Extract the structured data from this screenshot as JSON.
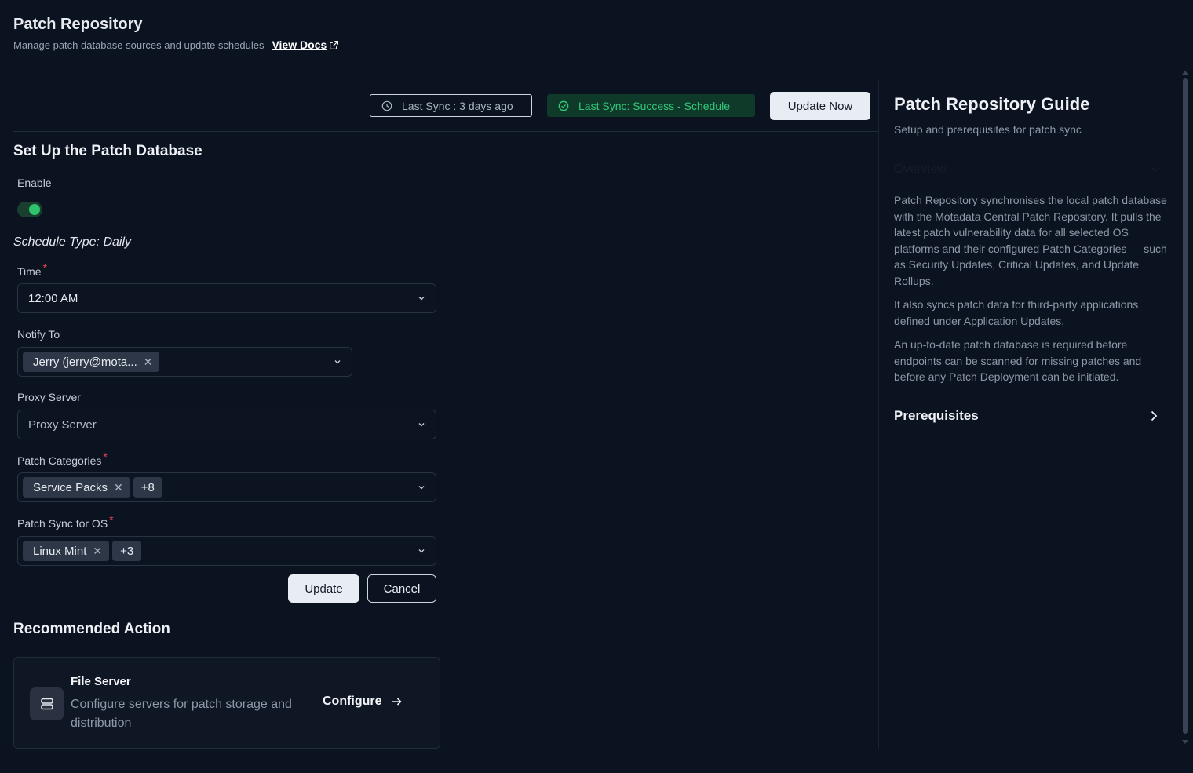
{
  "header": {
    "title": "Patch Repository",
    "subtitle": "Manage patch database sources and update schedules",
    "docs_link": "View Docs"
  },
  "toolbar": {
    "last_sync": "Last Sync : 3 days ago",
    "sync_status": "Last Sync: Success - Schedule",
    "update_now": "Update Now"
  },
  "form": {
    "section_title": "Set Up the Patch Database",
    "enable_label": "Enable",
    "enabled": true,
    "schedule_type": "Schedule Type: Daily",
    "time_label": "Time",
    "time_value": "12:00 AM",
    "notify_label": "Notify To",
    "notify_chip": "Jerry (jerry@mota...",
    "proxy_label": "Proxy Server",
    "proxy_placeholder": "Proxy Server",
    "categories_label": "Patch Categories",
    "categories_chip": "Service Packs",
    "categories_more": "+8",
    "os_label": "Patch Sync for OS",
    "os_chip": "Linux Mint",
    "os_more": "+3",
    "required_mark": "*",
    "update_button": "Update",
    "cancel_button": "Cancel"
  },
  "recommended": {
    "title": "Recommended Action",
    "card_title": "File Server",
    "card_desc": "Configure servers for patch storage and distribution",
    "card_action": "Configure"
  },
  "guide": {
    "title": "Patch Repository Guide",
    "subtitle": "Setup and prerequisites for patch sync",
    "overview_label": "Overview",
    "para1": "Patch Repository synchronises the local patch database with the Motadata Central Patch Repository. It pulls the latest patch vulnerability data for all selected OS platforms and their configured Patch Categories — such as Security Updates, Critical Updates, and Update Rollups.",
    "para2": "It also syncs patch data for third-party applications defined under Application Updates.",
    "para3": "An up-to-date patch database is required before endpoints can be scanned for missing patches and before any Patch Deployment can be initiated.",
    "prereq_label": "Prerequisites"
  },
  "colors": {
    "background": "#0b1220",
    "success": "#34c77b",
    "toggle_on": "#2fc36c",
    "required": "#e5484d"
  },
  "icons": [
    "external-link-icon",
    "clock-icon",
    "check-circle-icon",
    "chevron-down-icon",
    "close-icon",
    "server-icon",
    "arrow-right-icon",
    "chevron-right-icon"
  ]
}
